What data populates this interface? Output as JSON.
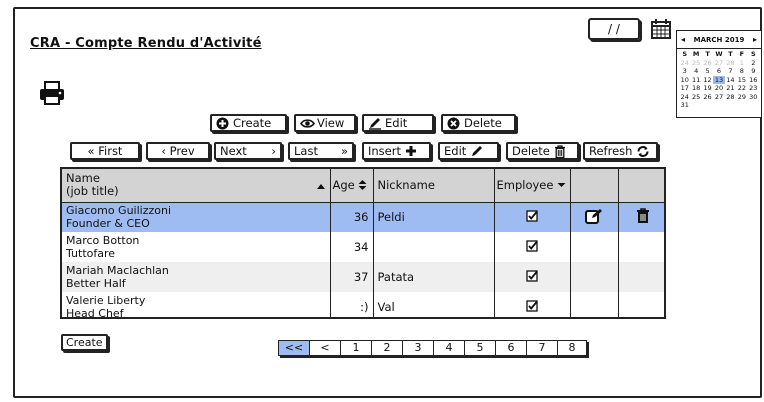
{
  "app": {
    "title": "CRA - Compte Rendu d'Activité"
  },
  "date_field": {
    "value": "/ /"
  },
  "calendar": {
    "month_label": "MARCH 2019",
    "days_of_week": [
      "S",
      "M",
      "T",
      "W",
      "T",
      "F",
      "S"
    ],
    "muted_days": [
      "24",
      "25",
      "26",
      "27",
      "28",
      "1"
    ],
    "days": [
      "2",
      "3",
      "4",
      "5",
      "6",
      "7",
      "8",
      "9",
      "10",
      "11",
      "12",
      "13",
      "14",
      "15",
      "16",
      "17",
      "18",
      "19",
      "20",
      "21",
      "22",
      "23",
      "24",
      "25",
      "26",
      "27",
      "28",
      "29",
      "30",
      "31"
    ],
    "selected_day": "13"
  },
  "toolbar": {
    "create_label": "Create",
    "view_label": "View",
    "edit_label": "Edit",
    "delete_label": "Delete"
  },
  "navbar": {
    "first_label": "« First",
    "prev_label": "‹ Prev",
    "next_label": "Next",
    "next_arrow": "›",
    "last_label": "Last",
    "last_arrow": "»",
    "insert_label": "Insert",
    "edit_label": "Edit",
    "delete_label": "Delete",
    "refresh_label": "Refresh"
  },
  "table": {
    "columns": {
      "name": "Name",
      "name_sub": "(job title)",
      "age": "Age",
      "nickname": "Nickname",
      "employee": "Employee"
    },
    "rows": [
      {
        "name": "Giacomo Guilizzoni",
        "title": "Founder & CEO",
        "age": "36",
        "nickname": "Peldi",
        "employee": true
      },
      {
        "name": "Marco Botton",
        "title": "Tuttofare",
        "age": "34",
        "nickname": "",
        "employee": true
      },
      {
        "name": "Mariah Maclachlan",
        "title": "Better Half",
        "age": "37",
        "nickname": "Patata",
        "employee": true
      },
      {
        "name": "Valerie Liberty",
        "title": "Head Chef",
        "age": ":)",
        "nickname": "Val",
        "employee": true
      }
    ]
  },
  "bottom": {
    "create_label": "Create"
  },
  "pager": {
    "items": [
      "<<",
      "<",
      "1",
      "2",
      "3",
      "4",
      "5",
      "6",
      "7",
      "8"
    ]
  },
  "colors": {
    "selection": "#9ebcf2",
    "header": "#d3d3d3",
    "border": "#222222"
  }
}
